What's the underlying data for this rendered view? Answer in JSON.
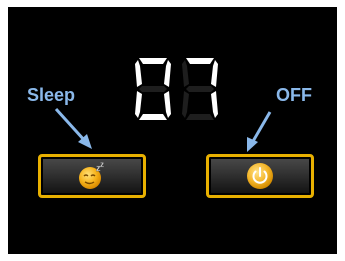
{
  "display": {
    "digits": [
      "0",
      "7"
    ],
    "digit_color_on": "#ffffff",
    "digit_color_off": "#1e1e1e"
  },
  "callouts": {
    "sleep_label": "Sleep",
    "off_label": "OFF",
    "color": "#8ab8ea"
  },
  "buttons": {
    "sleep": {
      "icon": "sleep-face-icon"
    },
    "off": {
      "icon": "power-icon"
    },
    "border_color": "#e8b000"
  }
}
